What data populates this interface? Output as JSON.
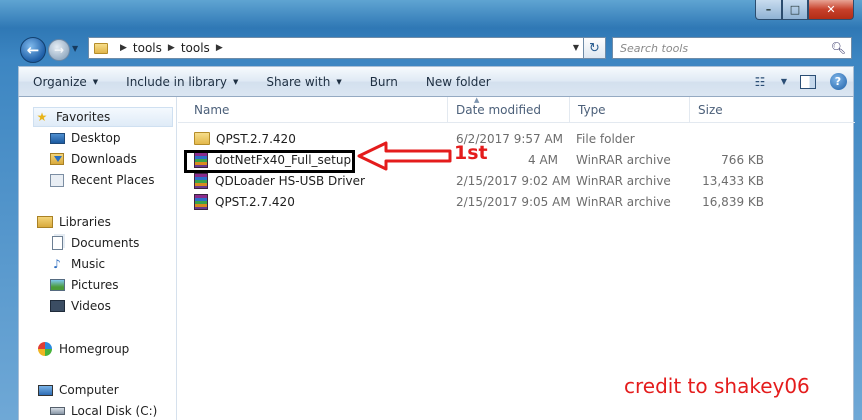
{
  "window": {
    "caption": {
      "minimize": "–",
      "maximize": "□",
      "close": "✕"
    }
  },
  "address": {
    "path": [
      "tools",
      "tools"
    ],
    "refresh_glyph": "↻"
  },
  "search": {
    "placeholder": "Search tools"
  },
  "toolbar": {
    "organize": "Organize",
    "include_in_library": "Include in library",
    "share_with": "Share with",
    "burn": "Burn",
    "new_folder": "New folder",
    "help": "?"
  },
  "nav": {
    "favorites": "Favorites",
    "desktop": "Desktop",
    "downloads": "Downloads",
    "recent_places": "Recent Places",
    "libraries": "Libraries",
    "documents": "Documents",
    "music": "Music",
    "pictures": "Pictures",
    "videos": "Videos",
    "homegroup": "Homegroup",
    "computer": "Computer",
    "local_disk": "Local Disk (C:)"
  },
  "columns": {
    "name": "Name",
    "date": "Date modified",
    "type": "Type",
    "size": "Size"
  },
  "files": [
    {
      "name": "QPST.2.7.420",
      "date": "6/2/2017 9:57 AM",
      "type": "File folder",
      "size": "",
      "icon": "folder-icon"
    },
    {
      "name": "dotNetFx40_Full_setup",
      "date": "4 AM",
      "type": "WinRAR archive",
      "size": "766 KB",
      "icon": "winrar-icon"
    },
    {
      "name": "QDLoader HS-USB Driver",
      "date": "2/15/2017 9:02 AM",
      "type": "WinRAR archive",
      "size": "13,433 KB",
      "icon": "winrar-icon"
    },
    {
      "name": "QPST.2.7.420",
      "date": "2/15/2017 9:05 AM",
      "type": "WinRAR archive",
      "size": "16,839 KB",
      "icon": "winrar-icon"
    }
  ],
  "annotations": {
    "step": "1st",
    "credit": "credit to shakey06",
    "accent_color": "#e41c1c"
  }
}
